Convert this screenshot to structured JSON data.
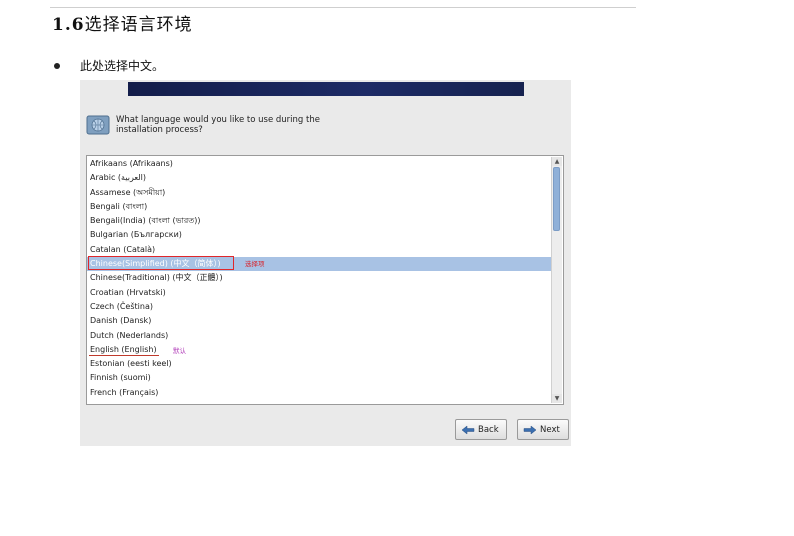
{
  "document": {
    "section_number": "1.6",
    "section_title": "选择语言环境",
    "bullet_text": "此处选择中文。"
  },
  "installer": {
    "question_line1": "What language would you like to use during the",
    "question_line2": "installation process?",
    "languages": [
      "Afrikaans (Afrikaans)",
      "Arabic (العربية)",
      "Assamese (অসমীয়া)",
      "Bengali (বাংলা)",
      "Bengali(India) (বাংলা (ভারত))",
      "Bulgarian (Български)",
      "Catalan (Català)",
      "Chinese(Simplified) (中文（简体）)",
      "Chinese(Traditional) (中文（正體）)",
      "Croatian (Hrvatski)",
      "Czech (Čeština)",
      "Danish (Dansk)",
      "Dutch (Nederlands)",
      "English (English)",
      "Estonian (eesti keel)",
      "Finnish (suomi)",
      "French (Français)"
    ],
    "selected_index": 7,
    "annotation_selected": "选择项",
    "annotation_default": "默认",
    "back_label": "Back",
    "next_label": "Next"
  },
  "colors": {
    "selection": "#a8c2e4",
    "highlight_box": "#e0272b",
    "annotation_red": "#d9232a",
    "annotation_purple": "#b03ab8",
    "banner": "#1d2b66"
  }
}
